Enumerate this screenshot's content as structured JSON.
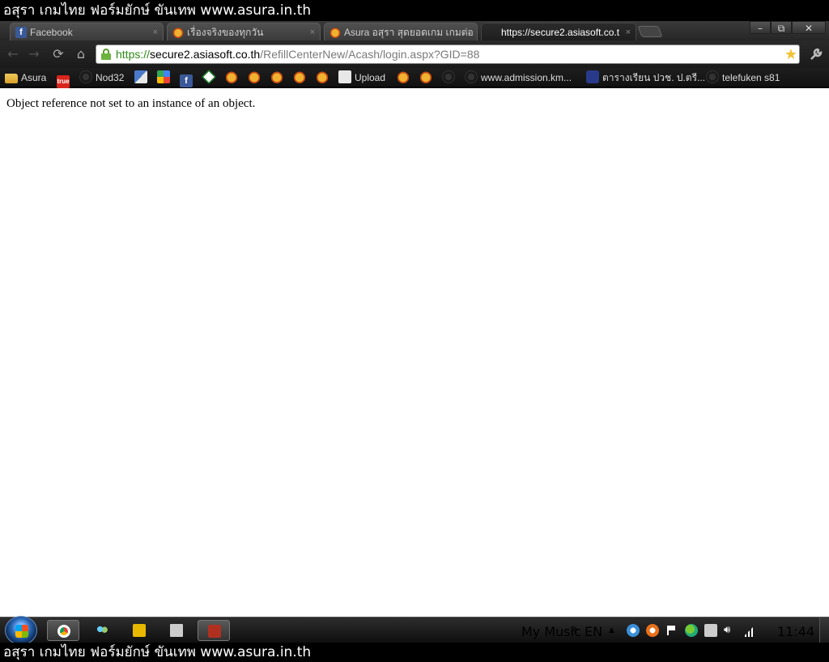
{
  "banner": {
    "text": "อสุรา เกมไทย ฟอร์มยักษ์ ขันเทพ www.asura.in.th"
  },
  "tabs": [
    {
      "title": "Facebook",
      "icon": "facebook-icon",
      "close": "×"
    },
    {
      "title": "เรื่องจริงของทุกวัน",
      "icon": "asura-icon",
      "close": "×"
    },
    {
      "title": "Asura อสุรา สุดยอดเกม เกมต่อ",
      "icon": "asura-icon",
      "close": "×"
    },
    {
      "title": "https://secure2.asiasoft.co.t",
      "icon": "",
      "close": "×"
    }
  ],
  "window_buttons": {
    "minimize": "–",
    "maximize": "⧉",
    "close": "✕"
  },
  "toolbar": {
    "back": "←",
    "forward": "→",
    "reload": "⟳",
    "home": "⌂",
    "star": "★",
    "wrench": "🔧"
  },
  "address": {
    "scheme": "https://",
    "host": "secure2.asiasoft.co.th",
    "path": "/RefillCenterNew/Acash/login.aspx?GID=88"
  },
  "bookmarks": {
    "asura": "Asura",
    "true": "true",
    "nod32": "Nod32",
    "upload": "Upload",
    "admission": "www.admission.km...",
    "timetable": "ตารางเรียน ปวช. ป.ตรี...",
    "telefuken": "telefuken s81"
  },
  "content": {
    "error": "Object reference not set to an instance of an object."
  },
  "taskbar": {
    "my_music": "My Music",
    "chevron": "»",
    "lang": "EN",
    "tray_arrow": "▲",
    "clock": "11:44"
  }
}
